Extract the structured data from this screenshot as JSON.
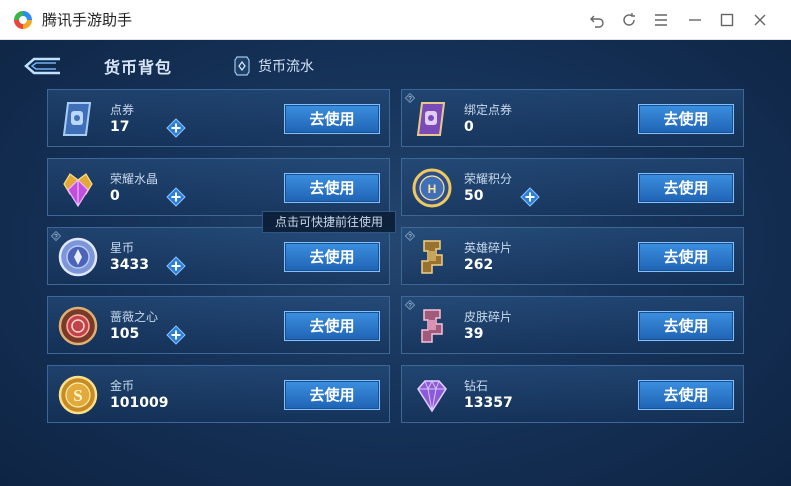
{
  "window": {
    "title": "腾讯手游助手",
    "buttons": [
      "back-icon",
      "refresh-icon",
      "menu-icon",
      "minimize-icon",
      "maximize-icon",
      "close-icon"
    ]
  },
  "header": {
    "active_tab": "货币背包",
    "flow_tab": "货币流水"
  },
  "use_label": "去使用",
  "tooltip": "点击可快捷前往使用",
  "left_items": [
    {
      "name": "点券",
      "value": "17",
      "icon": "coupon-icon"
    },
    {
      "name": "荣耀水晶",
      "value": "0",
      "icon": "crystal-icon"
    },
    {
      "name": "星币",
      "value": "3433",
      "icon": "star-coin-icon"
    },
    {
      "name": "蔷薇之心",
      "value": "105",
      "icon": "rose-heart-icon"
    },
    {
      "name": "金币",
      "value": "101009",
      "icon": "gold-coin-icon"
    }
  ],
  "right_items": [
    {
      "name": "绑定点券",
      "value": "0",
      "icon": "bound-coupon-icon"
    },
    {
      "name": "荣耀积分",
      "value": "50",
      "icon": "honor-points-icon"
    },
    {
      "name": "英雄碎片",
      "value": "262",
      "icon": "hero-fragment-icon"
    },
    {
      "name": "皮肤碎片",
      "value": "39",
      "icon": "skin-fragment-icon"
    },
    {
      "name": "钻石",
      "value": "13357",
      "icon": "diamond-icon"
    }
  ],
  "colors": {
    "background": "#16335a",
    "card_border": "#3d6796",
    "button_top": "#3c8fe0",
    "button_bottom": "#1f63b4",
    "plus": "#2b7fd6"
  }
}
